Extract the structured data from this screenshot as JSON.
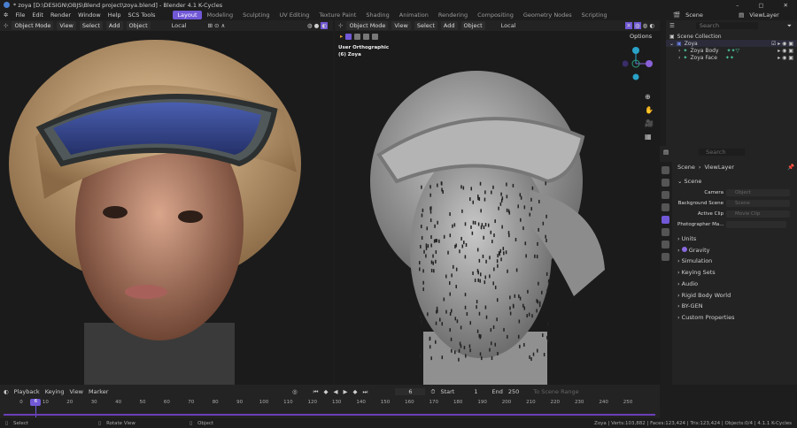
{
  "title": "* zoya [D:\\DESIGN\\OBJS\\Blend project\\zoya.blend] - Blender 4.1 K-Cycles",
  "menu": [
    "File",
    "Edit",
    "Render",
    "Window",
    "Help",
    "SCS Tools"
  ],
  "workspaces": [
    "Layout",
    "Modeling",
    "Sculpting",
    "UV Editing",
    "Texture Paint",
    "Shading",
    "Animation",
    "Rendering",
    "Compositing",
    "Geometry Nodes",
    "Scripting"
  ],
  "active_workspace": "Layout",
  "scene": "Scene",
  "view_layer": "ViewLayer",
  "viewport_header": {
    "mode": "Object Mode",
    "menus": [
      "View",
      "Select",
      "Add",
      "Object"
    ],
    "orientation": "Local",
    "options": "Options"
  },
  "right_viewport": {
    "view_name": "User Orthographic",
    "object": "(6) Zoya"
  },
  "outliner": {
    "search_placeholder": "Search",
    "root": "Scene Collection",
    "items": [
      {
        "name": "Zoya",
        "level": 0
      },
      {
        "name": "Zoya Body",
        "level": 1
      },
      {
        "name": "Zoya Face",
        "level": 1
      }
    ]
  },
  "properties": {
    "search_placeholder": "Search",
    "breadcrumb": [
      "Scene",
      "ViewLayer"
    ],
    "section": "Scene",
    "fields": [
      {
        "label": "Camera",
        "placeholder": "Object"
      },
      {
        "label": "Background Scene",
        "placeholder": "Scene"
      },
      {
        "label": "Active Clip",
        "placeholder": "Movie Clip"
      }
    ],
    "photographer": "Photographer Ma...",
    "panels": [
      "Units",
      "Gravity",
      "Simulation",
      "Keying Sets",
      "Audio",
      "Rigid Body World",
      "BY-GEN",
      "Custom Properties"
    ]
  },
  "timeline": {
    "menus": [
      "Playback",
      "Keying",
      "View",
      "Marker"
    ],
    "current_frame": "6",
    "start_label": "Start",
    "start": "1",
    "end_label": "End",
    "end": "250",
    "to_scene_range": "To Scene Range",
    "ticks": [
      "0",
      "10",
      "20",
      "30",
      "40",
      "50",
      "60",
      "70",
      "80",
      "90",
      "100",
      "110",
      "120",
      "130",
      "140",
      "150",
      "160",
      "170",
      "180",
      "190",
      "200",
      "210",
      "220",
      "230",
      "240",
      "250"
    ]
  },
  "status": {
    "hints": [
      "Select",
      "Rotate View",
      "Object"
    ],
    "stats": "Zoya | Verts:103,882 | Faces:123,424 | Tris:123,424 | Objects:0/4 | 4.1.1 K-Cycles"
  },
  "colors": {
    "accent": "#7158d6",
    "bg": "#1d1d1d",
    "panel": "#232323"
  }
}
